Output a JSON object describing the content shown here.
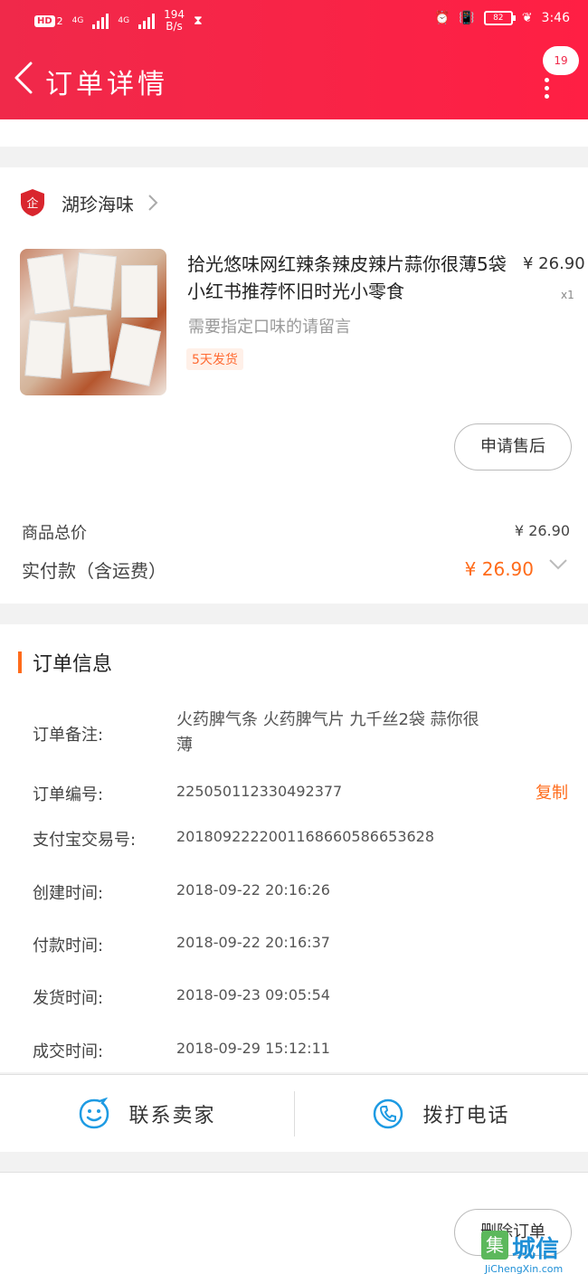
{
  "status_bar": {
    "network_left": "HD",
    "sim": "2",
    "net1": "4G",
    "net2": "4G",
    "speed_value": "194",
    "speed_unit": "B/s",
    "battery": "82",
    "time": "3:46"
  },
  "header": {
    "title": "订单详情",
    "badge": "19"
  },
  "shop": {
    "name": "湖珍海味"
  },
  "product": {
    "title": "拾光悠味网红辣条辣皮辣片蒜你很薄5袋小红书推荐怀旧时光小零食",
    "price": "¥ 26.90",
    "qty": "x1",
    "note": "需要指定口味的请留言",
    "tag": "5天发货",
    "after_sale": "申请售后"
  },
  "summary": {
    "total_label": "商品总价",
    "total_value": "¥ 26.90",
    "paid_label": "实付款（含运费）",
    "paid_value": "¥ 26.90"
  },
  "order_info": {
    "title": "订单信息",
    "remark_label": "订单备注:",
    "remark_value": "火药脾气条 火药脾气片 九千丝2袋 蒜你很薄",
    "number_label": "订单编号:",
    "number_value": "225050112330492377",
    "copy_label": "复制",
    "alipay_label": "支付宝交易号:",
    "alipay_value": "2018092222001168660586653628",
    "created_label": "创建时间:",
    "created_value": "2018-09-22  20:16:26",
    "paid_label": "付款时间:",
    "paid_value": "2018-09-22  20:16:37",
    "shipped_label": "发货时间:",
    "shipped_value": "2018-09-23  09:05:54",
    "done_label": "成交时间:",
    "done_value": "2018-09-29  15:12:11"
  },
  "actions": {
    "contact_seller": "联系卖家",
    "call": "拨打电话",
    "delete_order": "删除订单"
  },
  "watermark": {
    "box": "集",
    "text": "城信",
    "url": "JiChengXin.com"
  },
  "colors": {
    "brand_red": "#f0294a",
    "accent_orange": "#ff6b1a",
    "icon_blue": "#1e9be3"
  }
}
